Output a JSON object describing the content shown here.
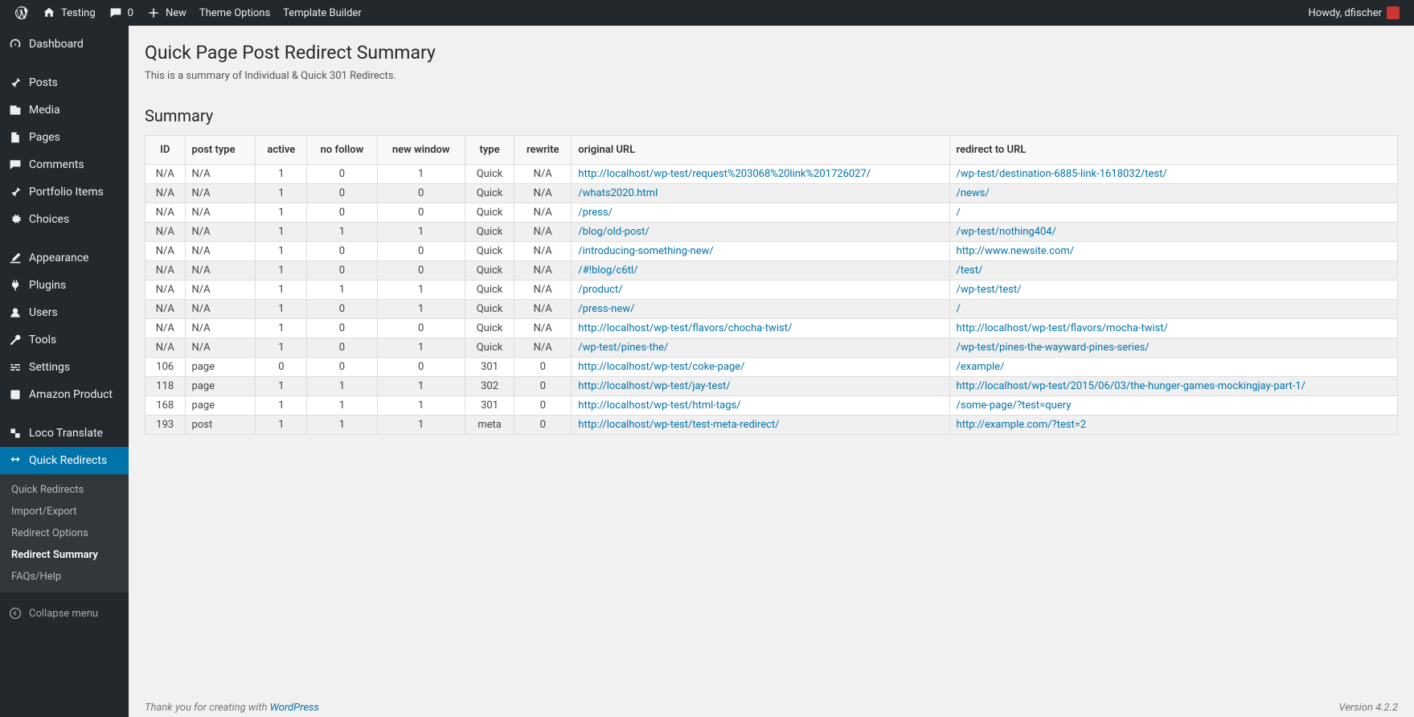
{
  "adminbar": {
    "site": "Testing",
    "comments": "0",
    "new": "New",
    "theme_options": "Theme Options",
    "template_builder": "Template Builder",
    "howdy": "Howdy, dfischer"
  },
  "sidebar": {
    "dashboard": "Dashboard",
    "posts": "Posts",
    "media": "Media",
    "pages": "Pages",
    "comments": "Comments",
    "portfolio": "Portfolio Items",
    "choices": "Choices",
    "appearance": "Appearance",
    "plugins": "Plugins",
    "users": "Users",
    "tools": "Tools",
    "settings": "Settings",
    "amazon": "Amazon Product",
    "loco": "Loco Translate",
    "quick_redirects": "Quick Redirects",
    "collapse": "Collapse menu"
  },
  "submenu": {
    "quick_redirects": "Quick Redirects",
    "import_export": "Import/Export",
    "redirect_options": "Redirect Options",
    "redirect_summary": "Redirect Summary",
    "faqs": "FAQs/Help"
  },
  "page": {
    "title": "Quick Page Post Redirect Summary",
    "desc": "This is a summary of Individual & Quick 301 Redirects.",
    "summary": "Summary"
  },
  "table": {
    "headers": [
      "ID",
      "post type",
      "active",
      "no follow",
      "new window",
      "type",
      "rewrite",
      "original URL",
      "redirect to URL"
    ],
    "rows": [
      [
        "N/A",
        "N/A",
        "1",
        "0",
        "1",
        "Quick",
        "N/A",
        "http://localhost/wp-test/request%203068%20link%201726027/",
        "/wp-test/destination-6885-link-1618032/test/"
      ],
      [
        "N/A",
        "N/A",
        "1",
        "0",
        "0",
        "Quick",
        "N/A",
        "/whats2020.html",
        "/news/"
      ],
      [
        "N/A",
        "N/A",
        "1",
        "0",
        "0",
        "Quick",
        "N/A",
        "/press/",
        "/"
      ],
      [
        "N/A",
        "N/A",
        "1",
        "1",
        "1",
        "Quick",
        "N/A",
        "/blog/old-post/",
        "/wp-test/nothing404/"
      ],
      [
        "N/A",
        "N/A",
        "1",
        "0",
        "0",
        "Quick",
        "N/A",
        "/introducing-something-new/",
        "http://www.newsite.com/"
      ],
      [
        "N/A",
        "N/A",
        "1",
        "0",
        "0",
        "Quick",
        "N/A",
        "/#!blog/c6tl/",
        "/test/"
      ],
      [
        "N/A",
        "N/A",
        "1",
        "1",
        "1",
        "Quick",
        "N/A",
        "/product/",
        "/wp-test/test/"
      ],
      [
        "N/A",
        "N/A",
        "1",
        "0",
        "1",
        "Quick",
        "N/A",
        "/press-new/",
        "/"
      ],
      [
        "N/A",
        "N/A",
        "1",
        "0",
        "0",
        "Quick",
        "N/A",
        "http://localhost/wp-test/flavors/chocha-twist/",
        "http://localhost/wp-test/flavors/mocha-twist/"
      ],
      [
        "N/A",
        "N/A",
        "1",
        "0",
        "1",
        "Quick",
        "N/A",
        "/wp-test/pines-the/",
        "/wp-test/pines-the-wayward-pines-series/"
      ],
      [
        "106",
        "page",
        "0",
        "0",
        "0",
        "301",
        "0",
        "http://localhost/wp-test/coke-page/",
        "/example/"
      ],
      [
        "118",
        "page",
        "1",
        "1",
        "1",
        "302",
        "0",
        "http://localhost/wp-test/jay-test/",
        "http://localhost/wp-test/2015/06/03/the-hunger-games-mockingjay-part-1/"
      ],
      [
        "168",
        "page",
        "1",
        "1",
        "1",
        "301",
        "0",
        "http://localhost/wp-test/html-tags/",
        "/some-page/?test=query"
      ],
      [
        "193",
        "post",
        "1",
        "1",
        "1",
        "meta",
        "0",
        "http://localhost/wp-test/test-meta-redirect/",
        "http://example.com/?test=2"
      ]
    ]
  },
  "footer": {
    "thanks_prefix": "Thank you for creating with ",
    "wordpress": "WordPress",
    "version": "Version 4.2.2"
  }
}
